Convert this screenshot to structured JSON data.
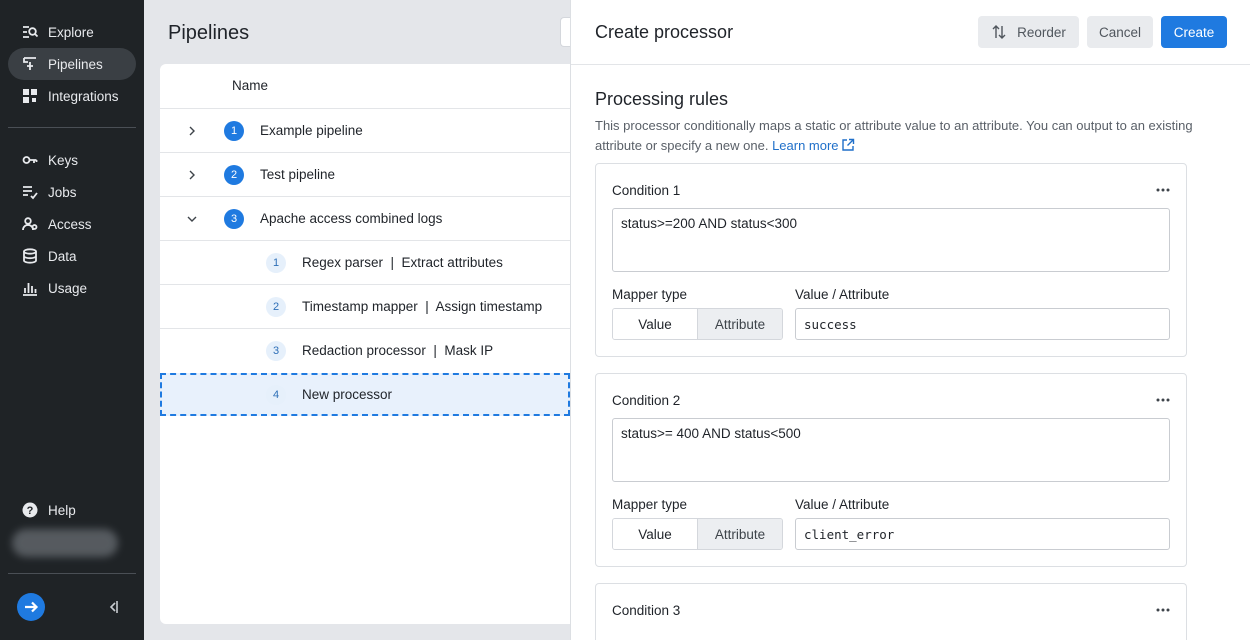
{
  "sidebar": {
    "items": [
      {
        "label": "Explore",
        "icon": "explore-icon"
      },
      {
        "label": "Pipelines",
        "icon": "pipelines-icon",
        "active": true
      },
      {
        "label": "Integrations",
        "icon": "integrations-icon"
      },
      {
        "label": "Keys",
        "icon": "key-icon"
      },
      {
        "label": "Jobs",
        "icon": "jobs-icon"
      },
      {
        "label": "Access",
        "icon": "access-icon"
      },
      {
        "label": "Data",
        "icon": "database-icon"
      },
      {
        "label": "Usage",
        "icon": "usage-icon"
      }
    ],
    "help_label": "Help"
  },
  "page": {
    "title": "Pipelines",
    "table": {
      "column_name": "Name",
      "rows": [
        {
          "num": "1",
          "label": "Example pipeline",
          "expanded": false
        },
        {
          "num": "2",
          "label": "Test pipeline",
          "expanded": false
        },
        {
          "num": "3",
          "label": "Apache access combined logs",
          "expanded": true
        }
      ],
      "processors": [
        {
          "num": "1",
          "label": "Regex parser  |  Extract attributes"
        },
        {
          "num": "2",
          "label": "Timestamp mapper  |  Assign timestamp"
        },
        {
          "num": "3",
          "label": "Redaction processor  |  Mask IP"
        },
        {
          "num": "4",
          "label": "New processor"
        }
      ]
    }
  },
  "drawer": {
    "title": "Create processor",
    "reorder_label": "Reorder",
    "cancel_label": "Cancel",
    "create_label": "Create",
    "section_title": "Processing rules",
    "section_desc": "This processor conditionally maps a static or attribute value to an attribute. You can output to an existing attribute or specify a new one.",
    "learn_more": "Learn more",
    "mapper_type_label": "Mapper type",
    "value_attr_label": "Value / Attribute",
    "seg_value": "Value",
    "seg_attribute": "Attribute",
    "conditions": [
      {
        "title": "Condition 1",
        "expr": "status>=200 AND status<300",
        "mapper": "Value",
        "value": "success"
      },
      {
        "title": "Condition 2",
        "expr": "status>= 400 AND status<500",
        "mapper": "Value",
        "value": "client_error"
      },
      {
        "title": "Condition 3"
      }
    ]
  },
  "colors": {
    "accent": "#1f7ae0",
    "sidebar_bg": "#1f2326",
    "page_bg": "#e4e6ea"
  }
}
